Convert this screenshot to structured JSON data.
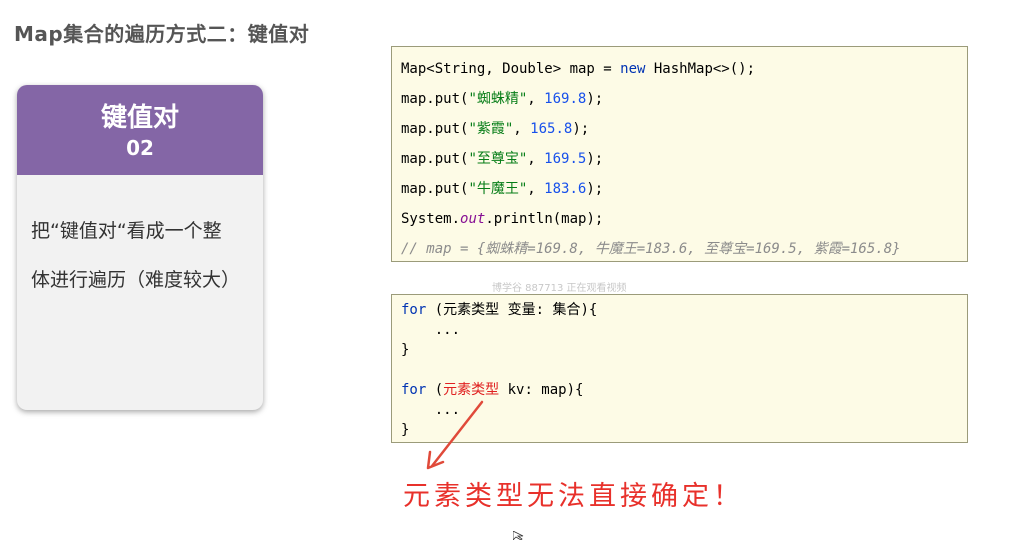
{
  "slide": {
    "title": "Map集合的遍历方式二：键值对",
    "card": {
      "heading": "键值对",
      "number": "02",
      "description_line1": "把“键值对“看成一个整",
      "description_line2": "体进行遍历（难度较大）"
    },
    "code_block1": {
      "line1": [
        "Map<String, Double> map = ",
        "new",
        " HashMap<>();"
      ],
      "put_lines": [
        {
          "prefix": "map.put(",
          "key": "\"蜘蛛精\"",
          "sep": ", ",
          "value": "169.8",
          "suffix": ");"
        },
        {
          "prefix": "map.put(",
          "key": "\"紫霞\"",
          "sep": ", ",
          "value": "165.8",
          "suffix": ");"
        },
        {
          "prefix": "map.put(",
          "key": "\"至尊宝\"",
          "sep": ", ",
          "value": "169.5",
          "suffix": ");"
        },
        {
          "prefix": "map.put(",
          "key": "\"牛魔王\"",
          "sep": ", ",
          "value": "183.6",
          "suffix": ");"
        }
      ],
      "println": [
        "System.",
        "out",
        ".println(map);"
      ],
      "comment": "// map = {蜘蛛精=169.8, 牛魔王=183.6, 至尊宝=169.5, 紫霞=165.8}"
    },
    "code_block2": {
      "for1": [
        "for",
        " (元素类型 变量: 集合){"
      ],
      "dots1": "    ...",
      "close1": "}",
      "for2": [
        "for",
        " (",
        "元素类型",
        " kv: map){"
      ],
      "dots2": "    ...",
      "close2": "}"
    },
    "watermark": "博学谷 887713 正在观看视频",
    "annotation": "元素类型无法直接确定！"
  },
  "colors": {
    "card_header": "#8466a6",
    "code_bg": "#fdfbe6",
    "keyword": "#0033b3",
    "string": "#067d17",
    "number": "#1750eb",
    "annotation": "#e8312b"
  }
}
